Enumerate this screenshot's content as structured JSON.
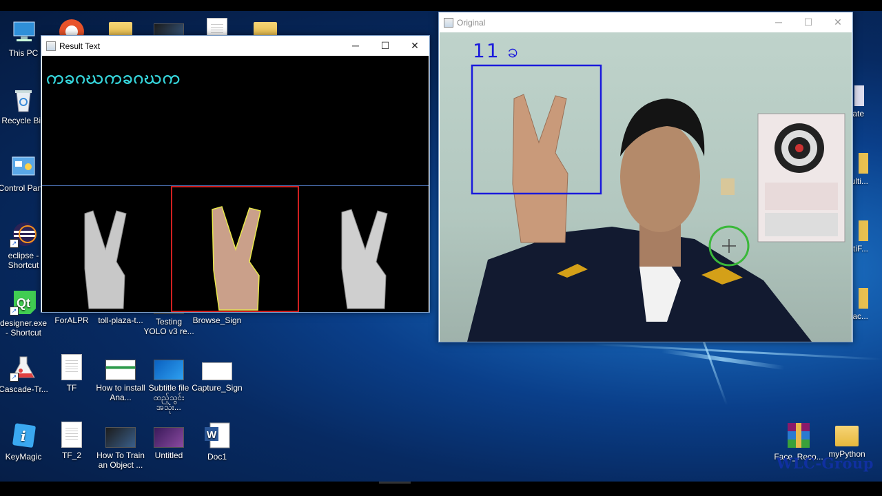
{
  "desktop": {
    "watermark": "WLC-Group",
    "icons": [
      {
        "label": "This PC",
        "icon": "computer-icon"
      },
      {
        "label": "Recycle Bin",
        "icon": "recycle-bin-icon"
      },
      {
        "label": "Control Panel",
        "icon": "control-panel-icon"
      },
      {
        "label": "eclipse - Shortcut",
        "icon": "eclipse-icon"
      },
      {
        "label": "designer.exe - Shortcut",
        "icon": "qt-designer-icon"
      },
      {
        "label": "Cascade-Tr...",
        "icon": "flask-icon"
      },
      {
        "label": "KeyMagic",
        "icon": "keymagic-icon"
      },
      {
        "label": "ForALPR",
        "icon": "folder-icon"
      },
      {
        "label": "TF",
        "icon": "document-icon"
      },
      {
        "label": "TF_2",
        "icon": "document-icon"
      },
      {
        "label": "toll-plaza-t...",
        "icon": "folder-icon"
      },
      {
        "label": "How to install Ana...",
        "icon": "video-icon"
      },
      {
        "label": "How To Train an Object ...",
        "icon": "video-icon"
      },
      {
        "label": "Testing YOLO v3 re...",
        "icon": "video-icon"
      },
      {
        "label": "Subtitle file ထည့်သွင်း အသုံး...",
        "icon": "video-icon"
      },
      {
        "label": "Untitled",
        "icon": "video-icon"
      },
      {
        "label": "Browse_Sign",
        "icon": "folder-icon"
      },
      {
        "label": "Capture_Sign",
        "icon": "image-icon"
      },
      {
        "label": "Doc1",
        "icon": "word-icon"
      },
      {
        "label": "Face_Reco...",
        "icon": "winrar-icon"
      },
      {
        "label": "myPython",
        "icon": "folder-icon"
      },
      {
        "label": "ate",
        "icon": "partial-icon"
      },
      {
        "label": "ulti...",
        "icon": "partial-icon"
      },
      {
        "label": "tiF...",
        "icon": "partial-icon"
      },
      {
        "label": "rac...",
        "icon": "partial-icon"
      }
    ]
  },
  "result_window": {
    "title": "Result Text",
    "recognized_text": "ကခဂဃကခဂဃက",
    "minimize": "─",
    "maximize": "☐",
    "close": "✕"
  },
  "original_window": {
    "title": "Original",
    "overlay_text": "11 ခ",
    "minimize": "─",
    "maximize": "☐",
    "close": "✕",
    "colors": {
      "roi_box": "#1a1adc",
      "overlay_text": "#1a1adc",
      "target_ring": "#3ab83a"
    }
  }
}
